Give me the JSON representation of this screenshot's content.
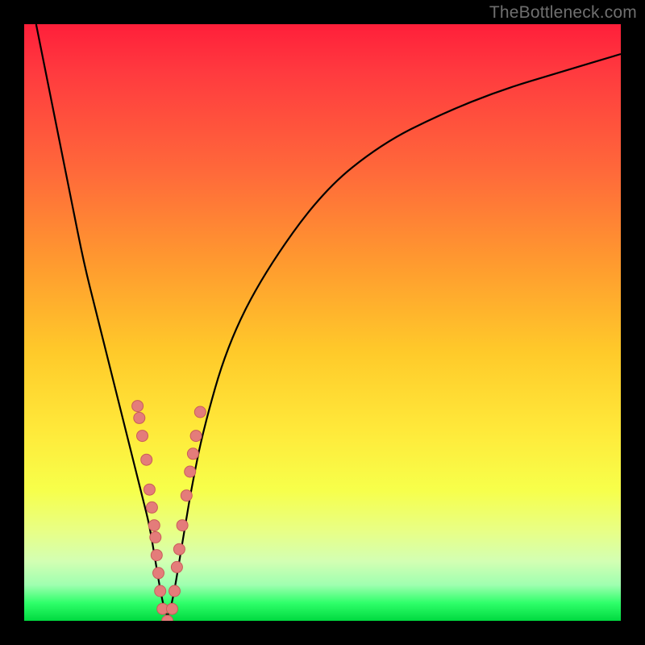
{
  "watermark": "TheBottleneck.com",
  "colors": {
    "frame": "#000000",
    "curve": "#000000",
    "marker_fill": "#e47c7a",
    "marker_stroke": "#c95c5a"
  },
  "chart_data": {
    "type": "line",
    "title": "",
    "xlabel": "",
    "ylabel": "",
    "xlim": [
      0,
      100
    ],
    "ylim": [
      0,
      100
    ],
    "grid": false,
    "legend": false,
    "series": [
      {
        "name": "bottleneck-curve",
        "x": [
          2,
          4,
          6,
          8,
          10,
          12,
          14,
          16,
          17,
          18,
          19,
          20,
          21,
          22,
          23,
          24,
          25,
          26,
          27,
          28,
          30,
          34,
          40,
          50,
          60,
          70,
          80,
          90,
          100
        ],
        "values": [
          100,
          90,
          80,
          70,
          60,
          52,
          44,
          36,
          32,
          28,
          24,
          20,
          16,
          10,
          4,
          0,
          4,
          10,
          16,
          22,
          32,
          46,
          58,
          72,
          80,
          85,
          89,
          92,
          95
        ]
      }
    ],
    "markers": [
      {
        "x": 19.0,
        "y": 36
      },
      {
        "x": 19.3,
        "y": 34
      },
      {
        "x": 19.8,
        "y": 31
      },
      {
        "x": 20.5,
        "y": 27
      },
      {
        "x": 21.0,
        "y": 22
      },
      {
        "x": 21.4,
        "y": 19
      },
      {
        "x": 21.8,
        "y": 16
      },
      {
        "x": 22.0,
        "y": 14
      },
      {
        "x": 22.2,
        "y": 11
      },
      {
        "x": 22.5,
        "y": 8
      },
      {
        "x": 22.8,
        "y": 5
      },
      {
        "x": 23.2,
        "y": 2
      },
      {
        "x": 24.0,
        "y": 0
      },
      {
        "x": 24.8,
        "y": 2
      },
      {
        "x": 25.2,
        "y": 5
      },
      {
        "x": 25.6,
        "y": 9
      },
      {
        "x": 26.0,
        "y": 12
      },
      {
        "x": 26.5,
        "y": 16
      },
      {
        "x": 27.2,
        "y": 21
      },
      {
        "x": 27.8,
        "y": 25
      },
      {
        "x": 28.3,
        "y": 28
      },
      {
        "x": 28.8,
        "y": 31
      },
      {
        "x": 29.5,
        "y": 35
      }
    ]
  }
}
